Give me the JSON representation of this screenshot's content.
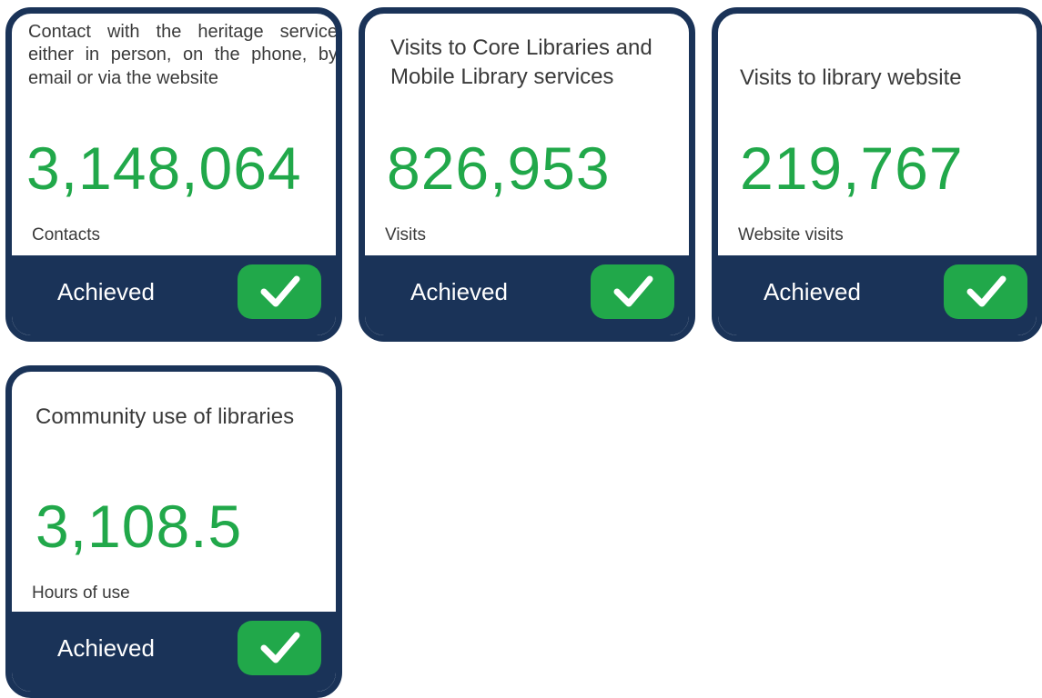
{
  "cards": [
    {
      "title": "Contact with the heritage service either in person, on the phone, by email or via the website",
      "value": "3,148,064",
      "unit": "Contacts",
      "status": "Achieved",
      "icon": "check-icon"
    },
    {
      "title": "Visits to Core Libraries and Mobile Library services",
      "value": "826,953",
      "unit": "Visits",
      "status": "Achieved",
      "icon": "check-icon"
    },
    {
      "title": "Visits to library website",
      "value": "219,767",
      "unit": "Website visits",
      "status": "Achieved",
      "icon": "check-icon"
    },
    {
      "title": "Community use of libraries",
      "value": "3,108.5",
      "unit": "Hours of use",
      "status": "Achieved",
      "icon": "check-icon"
    }
  ],
  "colors": {
    "navy": "#1a3358",
    "green": "#21a84a",
    "text": "#3a3a3a"
  }
}
